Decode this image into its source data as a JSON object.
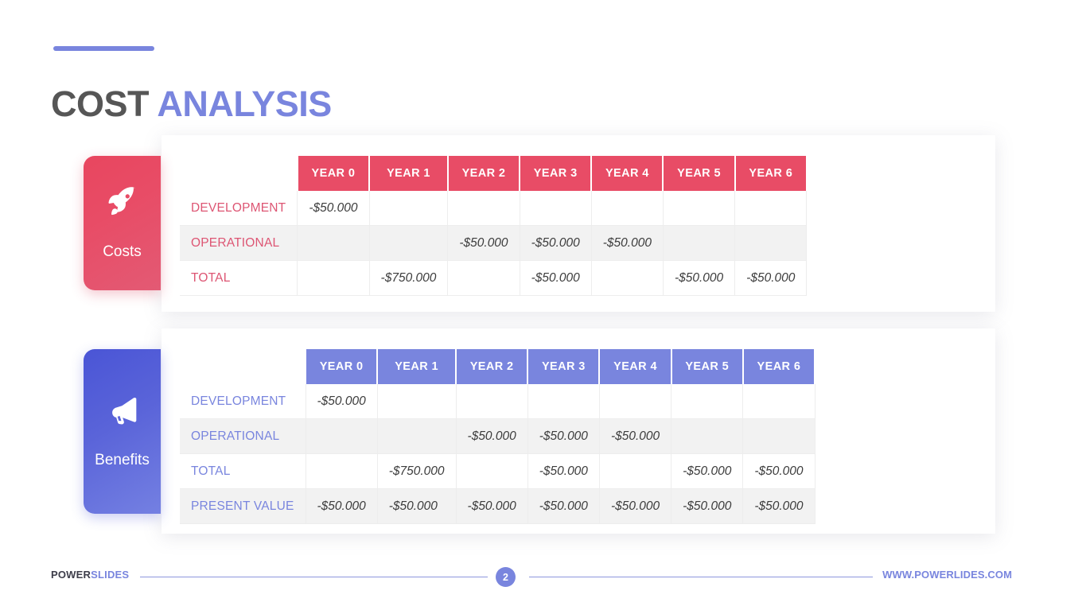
{
  "title": {
    "primary": "COST",
    "secondary": "ANALYSIS",
    "accent_color": "#7985de",
    "primary_color": "#565656"
  },
  "sections": [
    {
      "key": "costs",
      "card": {
        "label": "Costs",
        "icon": "rocket-icon",
        "color": "#e84c66"
      },
      "table": {
        "header_color": "#e84c66",
        "label_color": "#dd5573",
        "columns": [
          "",
          "YEAR 0",
          "YEAR 1",
          "YEAR 2",
          "YEAR 3",
          "YEAR 4",
          "YEAR 5",
          "YEAR 6"
        ],
        "rows": [
          {
            "label": "DEVELOPMENT",
            "values": [
              "-$50.000",
              "",
              "",
              "",
              "",
              "",
              ""
            ]
          },
          {
            "label": "OPERATIONAL",
            "values": [
              "",
              "",
              "-$50.000",
              "-$50.000",
              "-$50.000",
              "",
              ""
            ]
          },
          {
            "label": "TOTAL",
            "values": [
              "",
              "-$750.000",
              "",
              "-$50.000",
              "",
              "-$50.000",
              "-$50.000"
            ]
          }
        ]
      }
    },
    {
      "key": "benefits",
      "card": {
        "label": "Benefits",
        "icon": "megaphone-icon",
        "color": "#7985de"
      },
      "table": {
        "header_color": "#7985de",
        "label_color": "#7985de",
        "columns": [
          "",
          "YEAR 0",
          "YEAR 1",
          "YEAR 2",
          "YEAR 3",
          "YEAR 4",
          "YEAR 5",
          "YEAR 6"
        ],
        "rows": [
          {
            "label": "DEVELOPMENT",
            "values": [
              "-$50.000",
              "",
              "",
              "",
              "",
              "",
              ""
            ]
          },
          {
            "label": "OPERATIONAL",
            "values": [
              "",
              "",
              "-$50.000",
              "-$50.000",
              "-$50.000",
              "",
              ""
            ]
          },
          {
            "label": "TOTAL",
            "values": [
              "",
              "-$750.000",
              "",
              "-$50.000",
              "",
              "-$50.000",
              "-$50.000"
            ]
          },
          {
            "label": "PRESENT VALUE",
            "values": [
              "-$50.000",
              "-$50.000",
              "-$50.000",
              "-$50.000",
              "-$50.000",
              "-$50.000",
              "-$50.000"
            ]
          }
        ]
      }
    }
  ],
  "footer": {
    "brand_primary": "POWER",
    "brand_secondary": "SLIDES",
    "page_number": "2",
    "url": "WWW.POWERLIDES.COM"
  }
}
